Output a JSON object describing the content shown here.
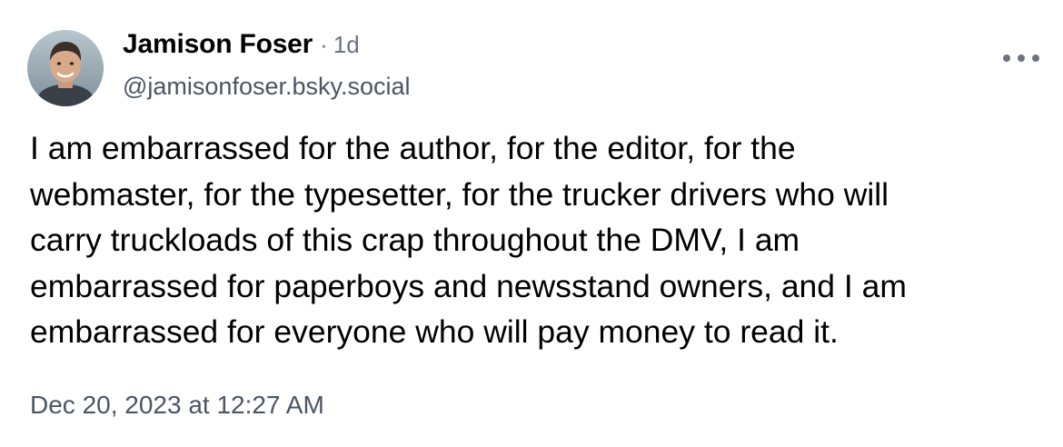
{
  "post": {
    "author": {
      "display_name": "Jamison Foser",
      "handle": "@jamisonfoser.bsky.social",
      "avatar_icon": "user-avatar-photo"
    },
    "separator": "·",
    "relative_time": "1d",
    "more_icon": "ellipsis-icon",
    "text": "I am embarrassed for the author, for the editor, for the\nwebmaster, for the typesetter, for the trucker drivers who will\ncarry truckloads of this crap throughout the DMV, I am\nembarrassed for paperboys and newsstand owners, and I am\nembarrassed for everyone who will pay money to read it.",
    "timestamp": "Dec 20, 2023 at 12:27 AM"
  },
  "colors": {
    "text_primary": "#000000",
    "text_secondary": "#4b5563",
    "text_muted": "#6b7280",
    "background": "#ffffff"
  }
}
